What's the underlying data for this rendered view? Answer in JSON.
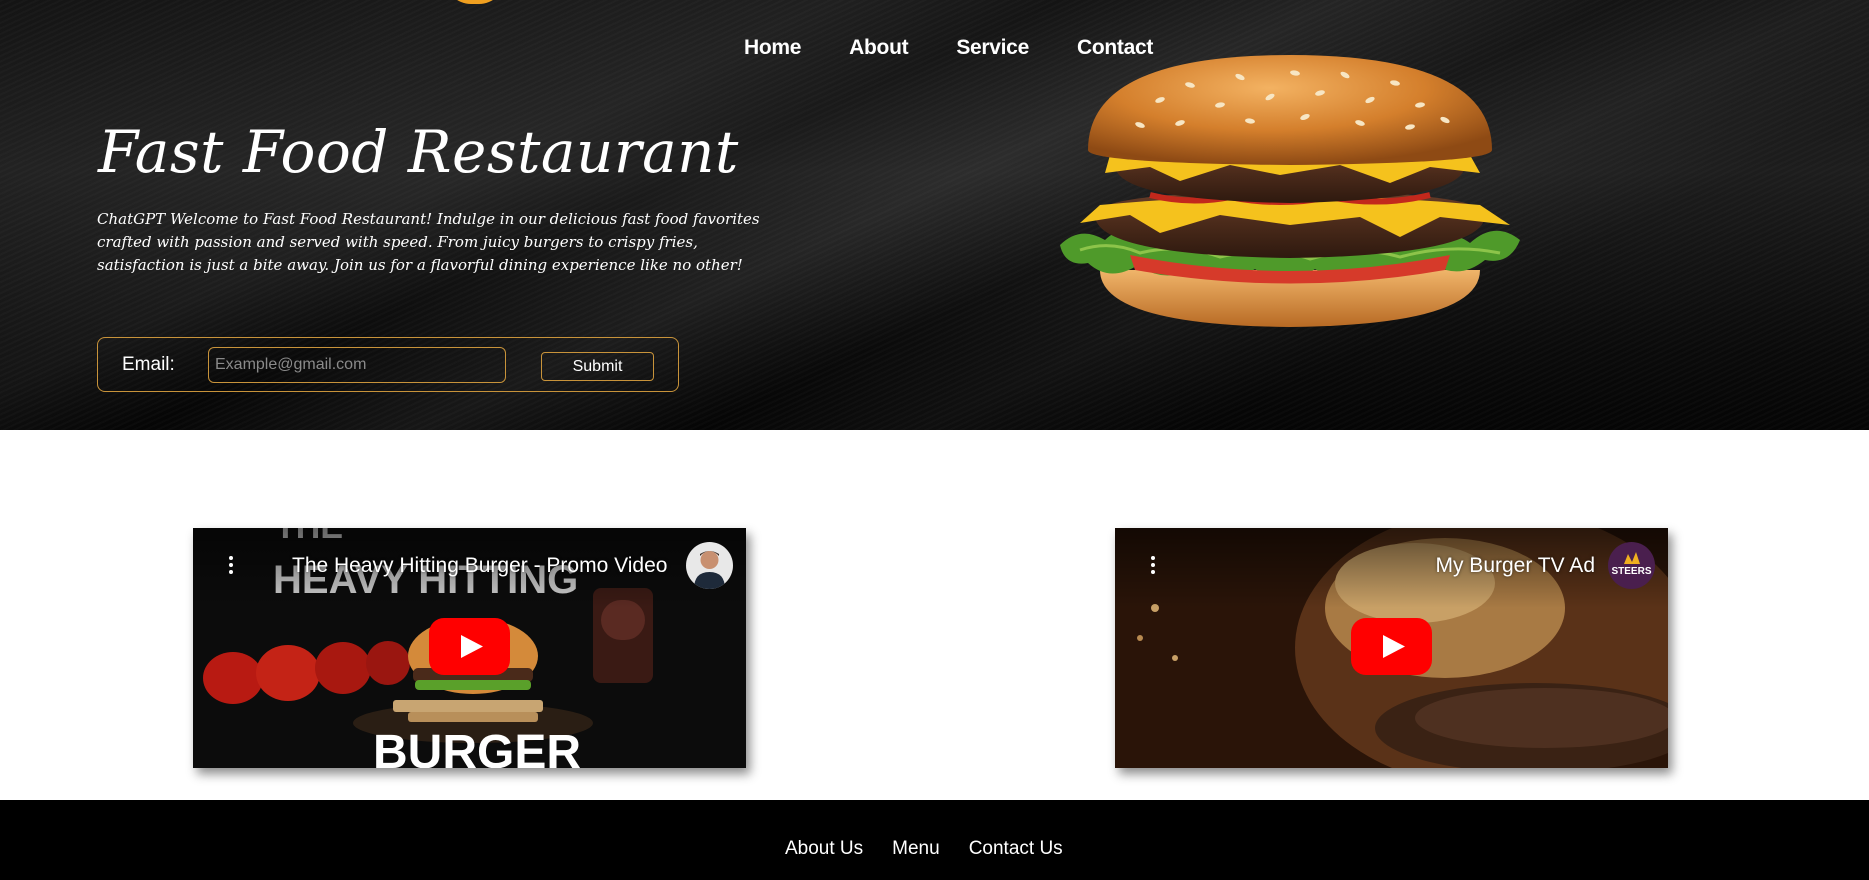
{
  "nav": {
    "items": [
      {
        "label": "Home"
      },
      {
        "label": "About"
      },
      {
        "label": "Service"
      },
      {
        "label": "Contact"
      }
    ]
  },
  "hero": {
    "title": "Fast Food Restaurant",
    "description": "ChatGPT Welcome to Fast Food Restaurant! Indulge in our delicious fast food favorites crafted with passion and served with speed. From juicy burgers to crispy fries, satisfaction is just a bite away. Join us for a flavorful dining experience like no other!"
  },
  "signup": {
    "label": "Email:",
    "placeholder": "Example@gmail.com",
    "value": "",
    "submit_label": "Submit"
  },
  "videos": [
    {
      "title": "The Heavy Hitting Burger - Promo Video",
      "thumbnail_text_top": "THE",
      "thumbnail_text_mid": "HEAVY HITTING",
      "thumbnail_text_bottom": "BURGER"
    },
    {
      "title": "My Burger TV Ad",
      "channel_badge": "STEERS"
    }
  ],
  "footer": {
    "links": [
      {
        "label": "About Us"
      },
      {
        "label": "Menu"
      },
      {
        "label": "Contact Us"
      }
    ]
  },
  "colors": {
    "accent": "#c8933a",
    "hero_bg": "#141414",
    "footer_bg": "#000000",
    "youtube_red": "#ff0000"
  },
  "icons": [
    "logo-peek",
    "burger-image",
    "video-menu-icon",
    "youtube-play-icon",
    "channel-avatar"
  ]
}
